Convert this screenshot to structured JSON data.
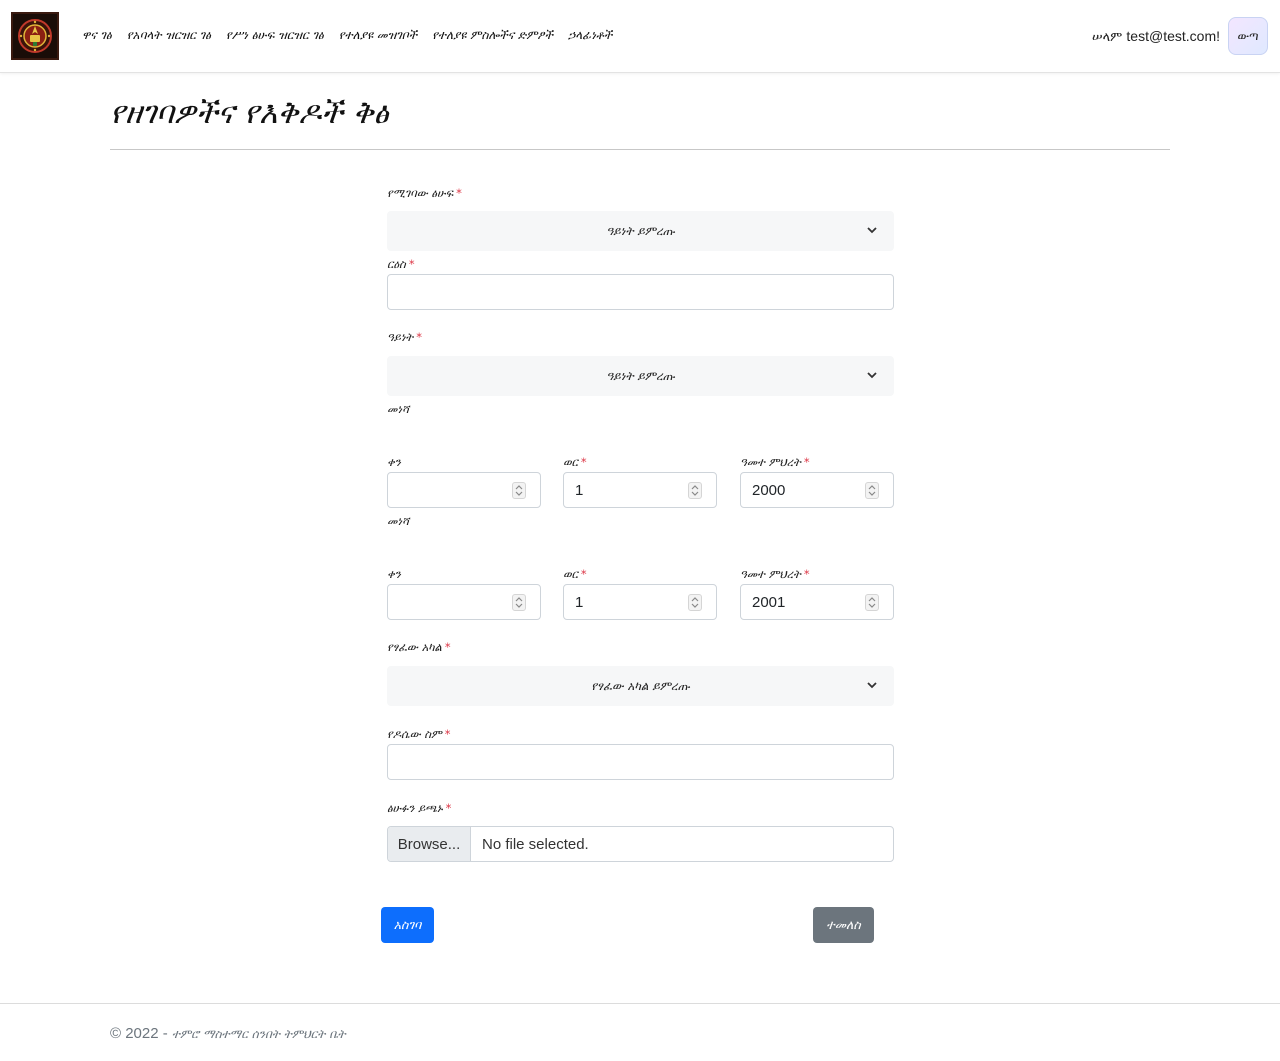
{
  "navbar": {
    "links": [
      "ዋና ገፅ",
      "የአባላት ዝርዝር ገፅ",
      "የሥነ ፅሁፍ ዝርዝር ገፅ",
      "የተለያዩ መዝገቦች",
      "የተለያዩ ምስሎችና ድምፆች",
      "ኃላፊነቶች"
    ],
    "greeting": "ሠላም",
    "user_email": "test@test.com!",
    "logout_label": "ውጣ"
  },
  "page": {
    "title": "የዘገባዎችና የእቅዶች ቅፅ"
  },
  "form": {
    "doc_type_label": "የሚገባው ፅሁፍ",
    "doc_type_value": "ዓይነት ይምረጡ",
    "subject_label": "ርዕስ",
    "subject_value": "",
    "kind_label": "ዓይነት",
    "kind_value": "ዓይነት ይምረጡ",
    "from_label": "መነሻ",
    "from_day_label": "ቀን",
    "from_day_value": "",
    "from_month_label": "ወር",
    "from_month_value": "1",
    "from_year_label": "ዓመተ ምህረት",
    "from_year_value": "2000",
    "to_label": "መነሻ",
    "to_day_label": "ቀን",
    "to_day_value": "",
    "to_month_label": "ወር",
    "to_month_value": "1",
    "to_year_label": "ዓመተ ምህረት",
    "to_year_value": "2001",
    "author_body_label": "የፃፈው አካል",
    "author_body_value": "የፃፈው አካል ይምረጡ",
    "filename_label": "የዶሴው ስም",
    "filename_value": "",
    "upload_label": "ፅሁፉን ይጫኑ",
    "browse_label": "Browse...",
    "file_status": "No file selected.",
    "submit_label": "አስገባ",
    "cancel_label": "ተመለስ",
    "required_mark": "*"
  },
  "footer": {
    "copyright_symbol": "©",
    "year": "2022",
    "separator": "-",
    "org_name": "ተምሮ ማስተማር ሰንበት ትምህርት ቤት"
  },
  "colors": {
    "primary": "#0d6efd",
    "secondary": "#6c757d",
    "required": "#dc3545"
  },
  "icons": {
    "logo": "church-emblem-icon",
    "select_arrow": "chevron-down-icon",
    "number_spinner": "spinner-arrows-icon"
  }
}
